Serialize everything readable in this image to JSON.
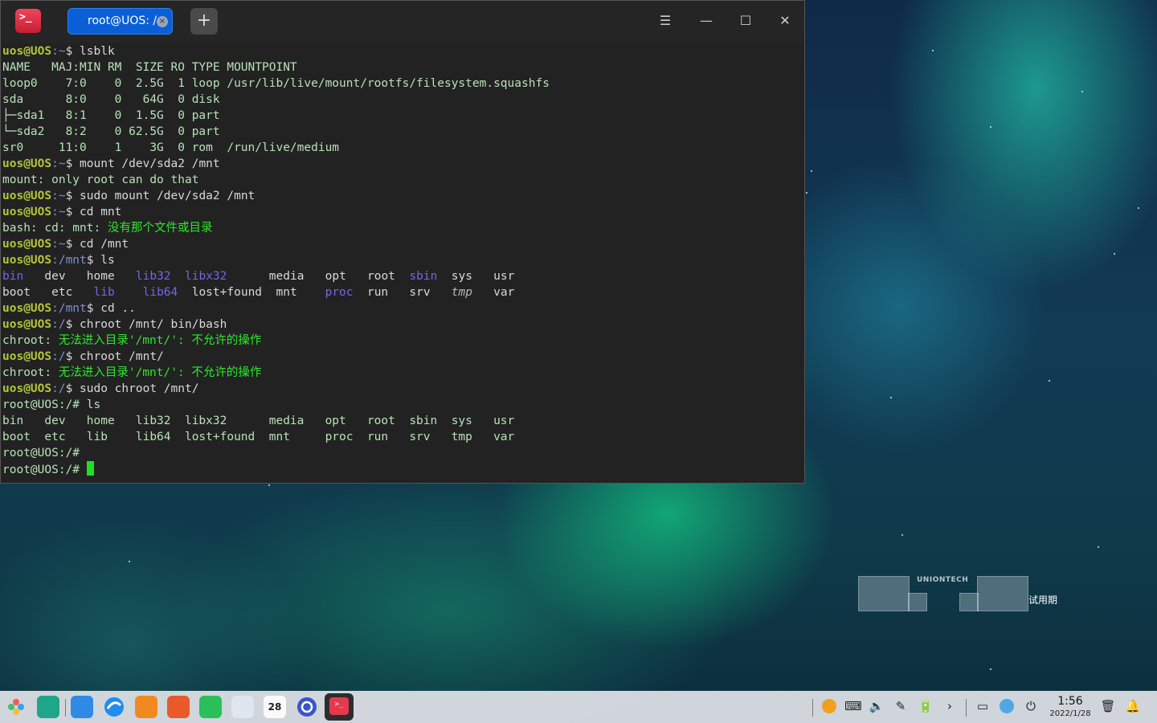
{
  "terminal": {
    "tab_title": "root@UOS: /",
    "tab_close": "×",
    "new_tab": "+",
    "menu_icon": "☰",
    "minimize_icon": "—",
    "maximize_icon": "☐",
    "close_icon": "✕",
    "app_icon_glyph": ">_",
    "lines": [
      [
        {
          "c": "ul",
          "t": "uos@UOS"
        },
        {
          "c": "up",
          "t": ":~"
        },
        {
          "c": "cmd",
          "t": "$ lsblk"
        }
      ],
      [
        {
          "c": "out",
          "t": "NAME   MAJ:MIN RM  SIZE RO TYPE MOUNTPOINT"
        }
      ],
      [
        {
          "c": "out",
          "t": "loop0    7:0    0  2.5G  1 loop /usr/lib/live/mount/rootfs/filesystem.squashfs"
        }
      ],
      [
        {
          "c": "out",
          "t": "sda      8:0    0   64G  0 disk "
        }
      ],
      [
        {
          "c": "out",
          "t": "├─sda1   8:1    0  1.5G  0 part "
        }
      ],
      [
        {
          "c": "out",
          "t": "└─sda2   8:2    0 62.5G  0 part "
        }
      ],
      [
        {
          "c": "out",
          "t": "sr0     11:0    1    3G  0 rom  /run/live/medium"
        }
      ],
      [
        {
          "c": "ul",
          "t": "uos@UOS"
        },
        {
          "c": "up",
          "t": ":~"
        },
        {
          "c": "cmd",
          "t": "$ mount /dev/sda2 /mnt"
        }
      ],
      [
        {
          "c": "out",
          "t": "mount: only root can do that"
        }
      ],
      [
        {
          "c": "ul",
          "t": "uos@UOS"
        },
        {
          "c": "up",
          "t": ":~"
        },
        {
          "c": "cmd",
          "t": "$ sudo mount /dev/sda2 /mnt"
        }
      ],
      [
        {
          "c": "ul",
          "t": "uos@UOS"
        },
        {
          "c": "up",
          "t": ":~"
        },
        {
          "c": "cmd",
          "t": "$ cd mnt"
        }
      ],
      [
        {
          "c": "out",
          "t": "bash: cd: mnt: "
        },
        {
          "c": "err",
          "t": "没有那个文件或目录"
        }
      ],
      [
        {
          "c": "ul",
          "t": "uos@UOS"
        },
        {
          "c": "up",
          "t": ":~"
        },
        {
          "c": "cmd",
          "t": "$ cd /mnt"
        }
      ],
      [
        {
          "c": "ul",
          "t": "uos@UOS"
        },
        {
          "c": "up",
          "t": ":/mnt"
        },
        {
          "c": "cmd",
          "t": "$ ls"
        }
      ],
      [
        {
          "c": "dir",
          "t": "bin"
        },
        {
          "c": "cmd",
          "t": "   dev   home   "
        },
        {
          "c": "dir",
          "t": "lib32  libx32"
        },
        {
          "c": "cmd",
          "t": "      media   opt   root  "
        },
        {
          "c": "dir",
          "t": "sbin"
        },
        {
          "c": "cmd",
          "t": "  sys   usr"
        }
      ],
      [
        {
          "c": "cmd",
          "t": "boot   etc   "
        },
        {
          "c": "dir",
          "t": "lib    lib64"
        },
        {
          "c": "cmd",
          "t": "  lost+found  mnt    "
        },
        {
          "c": "dir",
          "t": "proc"
        },
        {
          "c": "cmd",
          "t": "  run   srv   "
        },
        {
          "c": "it",
          "t": "tmp"
        },
        {
          "c": "cmd",
          "t": "   var"
        }
      ],
      [
        {
          "c": "ul",
          "t": "uos@UOS"
        },
        {
          "c": "up",
          "t": ":/mnt"
        },
        {
          "c": "cmd",
          "t": "$ cd .."
        }
      ],
      [
        {
          "c": "ul",
          "t": "uos@UOS"
        },
        {
          "c": "up",
          "t": ":/"
        },
        {
          "c": "cmd",
          "t": "$ chroot /mnt/ bin/bash"
        }
      ],
      [
        {
          "c": "out",
          "t": "chroot: "
        },
        {
          "c": "err",
          "t": "无法进入目录'/mnt/': 不允许的操作"
        }
      ],
      [
        {
          "c": "ul",
          "t": "uos@UOS"
        },
        {
          "c": "up",
          "t": ":/"
        },
        {
          "c": "cmd",
          "t": "$ chroot /mnt/"
        }
      ],
      [
        {
          "c": "out",
          "t": "chroot: "
        },
        {
          "c": "err",
          "t": "无法进入目录'/mnt/': 不允许的操作"
        }
      ],
      [
        {
          "c": "ul",
          "t": "uos@UOS"
        },
        {
          "c": "up",
          "t": ":/"
        },
        {
          "c": "cmd",
          "t": "$ sudo chroot /mnt/"
        }
      ],
      [
        {
          "c": "out",
          "t": "root@UOS:/# ls"
        }
      ],
      [
        {
          "c": "out",
          "t": "bin   dev   home   lib32  libx32      media   opt   root  sbin  sys   usr"
        }
      ],
      [
        {
          "c": "out",
          "t": "boot  etc   lib    lib64  lost+found  mnt     proc  run   srv   tmp   var"
        }
      ],
      [
        {
          "c": "out",
          "t": "root@UOS:/# "
        }
      ],
      [
        {
          "c": "out",
          "t": "root@UOS:/# "
        },
        {
          "c": "cursor",
          "t": ""
        }
      ]
    ]
  },
  "watermark": {
    "logo": "UNIONTECH",
    "text": "试用期"
  },
  "taskbar": {
    "calendar_day": "28",
    "time": "1:56",
    "date": "2022/1/28",
    "terminal_glyph": ">_"
  }
}
